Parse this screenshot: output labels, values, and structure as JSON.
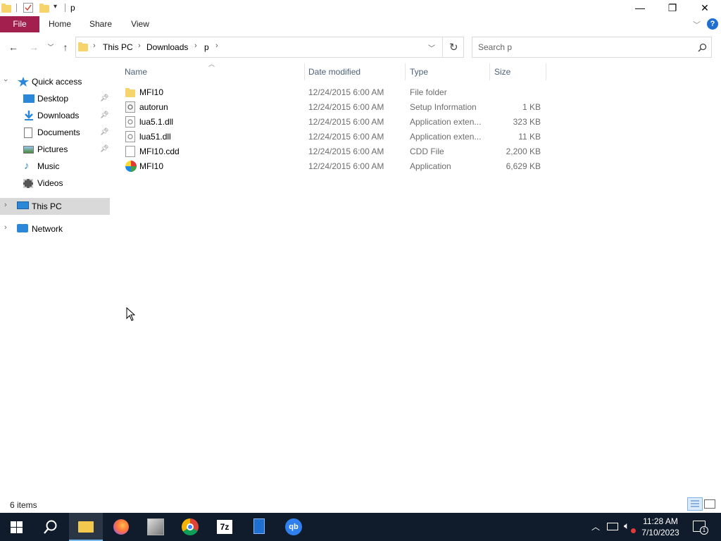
{
  "window": {
    "title": "p",
    "controls": {
      "minimize": "—",
      "maximize": "❐",
      "close": "✕"
    }
  },
  "ribbon": {
    "tabs": [
      {
        "label": "File"
      },
      {
        "label": "Home"
      },
      {
        "label": "Share"
      },
      {
        "label": "View"
      }
    ],
    "help": "?"
  },
  "address": {
    "breadcrumbs": [
      "This PC",
      "Downloads",
      "p"
    ]
  },
  "search": {
    "placeholder": "Search p"
  },
  "navpane": {
    "quick_access": "Quick access",
    "items": [
      {
        "label": "Desktop",
        "icon": "desktop-icon",
        "pinned": true
      },
      {
        "label": "Downloads",
        "icon": "downloads-icon",
        "pinned": true
      },
      {
        "label": "Documents",
        "icon": "documents-icon",
        "pinned": true
      },
      {
        "label": "Pictures",
        "icon": "pictures-icon",
        "pinned": true
      },
      {
        "label": "Music",
        "icon": "music-icon",
        "pinned": false
      },
      {
        "label": "Videos",
        "icon": "videos-icon",
        "pinned": false
      }
    ],
    "this_pc": "This PC",
    "network": "Network"
  },
  "columns": {
    "name": "Name",
    "date": "Date modified",
    "type": "Type",
    "size": "Size"
  },
  "files": [
    {
      "name": "MFI10",
      "date": "12/24/2015 6:00 AM",
      "type": "File folder",
      "size": "",
      "icon": "folder-icon"
    },
    {
      "name": "autorun",
      "date": "12/24/2015 6:00 AM",
      "type": "Setup Information",
      "size": "1 KB",
      "icon": "setup-info-icon"
    },
    {
      "name": "lua5.1.dll",
      "date": "12/24/2015 6:00 AM",
      "type": "Application exten...",
      "size": "323 KB",
      "icon": "dll-icon"
    },
    {
      "name": "lua51.dll",
      "date": "12/24/2015 6:00 AM",
      "type": "Application exten...",
      "size": "11 KB",
      "icon": "dll-icon"
    },
    {
      "name": "MFI10.cdd",
      "date": "12/24/2015 6:00 AM",
      "type": "CDD File",
      "size": "2,200 KB",
      "icon": "file-icon"
    },
    {
      "name": "MFI10",
      "date": "12/24/2015 6:00 AM",
      "type": "Application",
      "size": "6,629 KB",
      "icon": "app-icon"
    }
  ],
  "status": {
    "count": "6 items"
  },
  "taskbar": {
    "apps": [
      {
        "icon": "start-icon"
      },
      {
        "icon": "search-icon"
      },
      {
        "icon": "file-explorer-icon",
        "active": true
      },
      {
        "icon": "firefox-icon"
      },
      {
        "icon": "app-icon"
      },
      {
        "icon": "chrome-icon"
      },
      {
        "icon": "7zip-icon",
        "label": "7z"
      },
      {
        "icon": "calculator-icon"
      },
      {
        "icon": "qbittorrent-icon",
        "label": "qb"
      }
    ],
    "time": "11:28 AM",
    "date": "7/10/2023",
    "notifications": "1"
  }
}
